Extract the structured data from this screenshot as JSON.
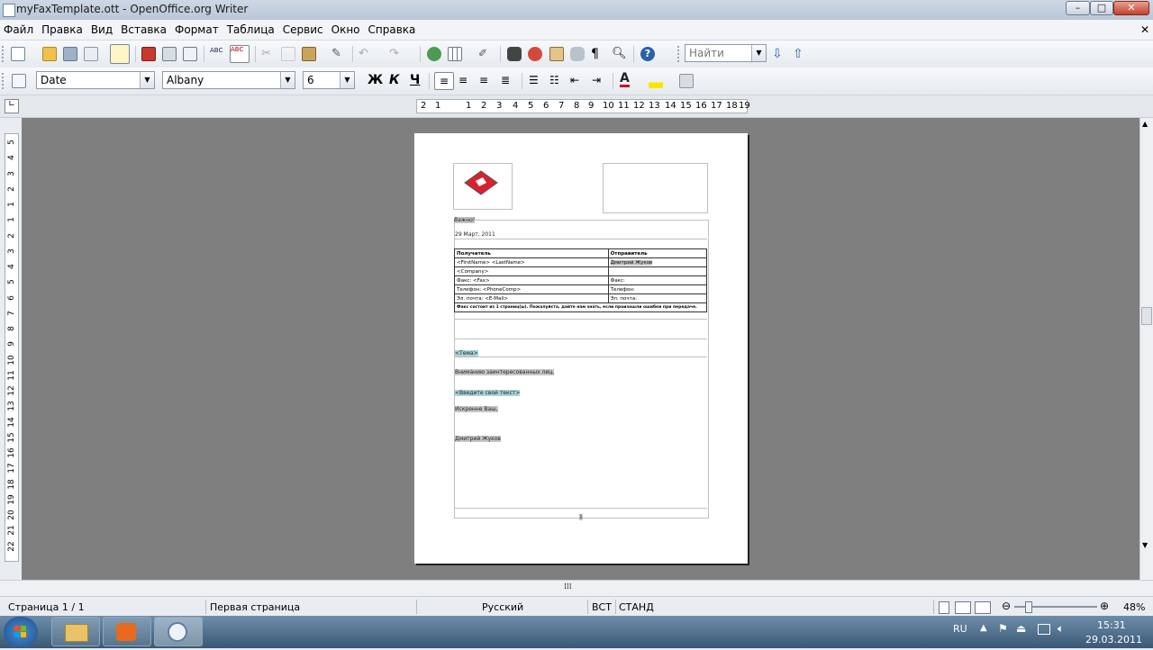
{
  "window": {
    "title": "myFaxTemplate.ott - OpenOffice.org Writer"
  },
  "menu": [
    "Файл",
    "Правка",
    "Вид",
    "Вставка",
    "Формат",
    "Таблица",
    "Сервис",
    "Окно",
    "Справка"
  ],
  "toolbar": {
    "find_placeholder": "Найти",
    "style_value": "Date",
    "font_value": "Albany",
    "size_value": "6",
    "bold_label": "Ж",
    "italic_label": "К",
    "underline_label": "Ч",
    "font_color_label": "A"
  },
  "ruler": {
    "h_ticks": [
      "2",
      "1",
      "1",
      "2",
      "3",
      "4",
      "5",
      "6",
      "7",
      "8",
      "9",
      "10",
      "11",
      "12",
      "13",
      "14",
      "15",
      "16",
      "17",
      "18",
      "19"
    ],
    "v_ticks": [
      "5",
      "4",
      "3",
      "2",
      "1",
      "1",
      "2",
      "3",
      "4",
      "5",
      "6",
      "7",
      "8",
      "9",
      "10",
      "11",
      "12",
      "13",
      "14",
      "15",
      "16",
      "17",
      "18",
      "19",
      "20",
      "21",
      "22"
    ]
  },
  "document": {
    "important": "Важно!",
    "date": "29 Март, 2011",
    "table_headers": [
      "Получатель",
      "Отправитель"
    ],
    "table_rows": [
      [
        "<FirstName> <LastName>",
        "Дмитрий Жуков"
      ],
      [
        "<Company>",
        ""
      ],
      [
        "Факс: <Fax>",
        "Факс:"
      ],
      [
        "Телефон: <PhoneComp>",
        "Телефон:"
      ],
      [
        "Эл. почта: <E-Mail>",
        "Эл. почта:"
      ]
    ],
    "pages_note": "Факс состоит из 1 страниц(ы). Пожалуйста, дайте нам знать, если произошли ошибки при передаче.",
    "topic": "<Тема>",
    "greeting": "Вниманию заинтересованных лиц,",
    "body_placeholder": "<Введите свой текст>",
    "closing": "Искренне Ваш,",
    "signature": "Дмитрий Жуков",
    "footer_mark": "1"
  },
  "statusbar": {
    "page": "Страница  1 / 1",
    "page_style": "Первая страница",
    "language": "Русский",
    "insert_mode": "ВСТ",
    "selection_mode": "СТАНД",
    "zoom": "48%"
  },
  "taskbar": {
    "lang": "RU",
    "time": "15:31",
    "date": "29.03.2011"
  },
  "colors": {
    "workspace": "#7f7f7f",
    "titlebar": "#c4d1df",
    "highlight": "#c6c6c6",
    "field_highlight": "#a9d3d9",
    "taskbar": "#4f6f8c"
  }
}
